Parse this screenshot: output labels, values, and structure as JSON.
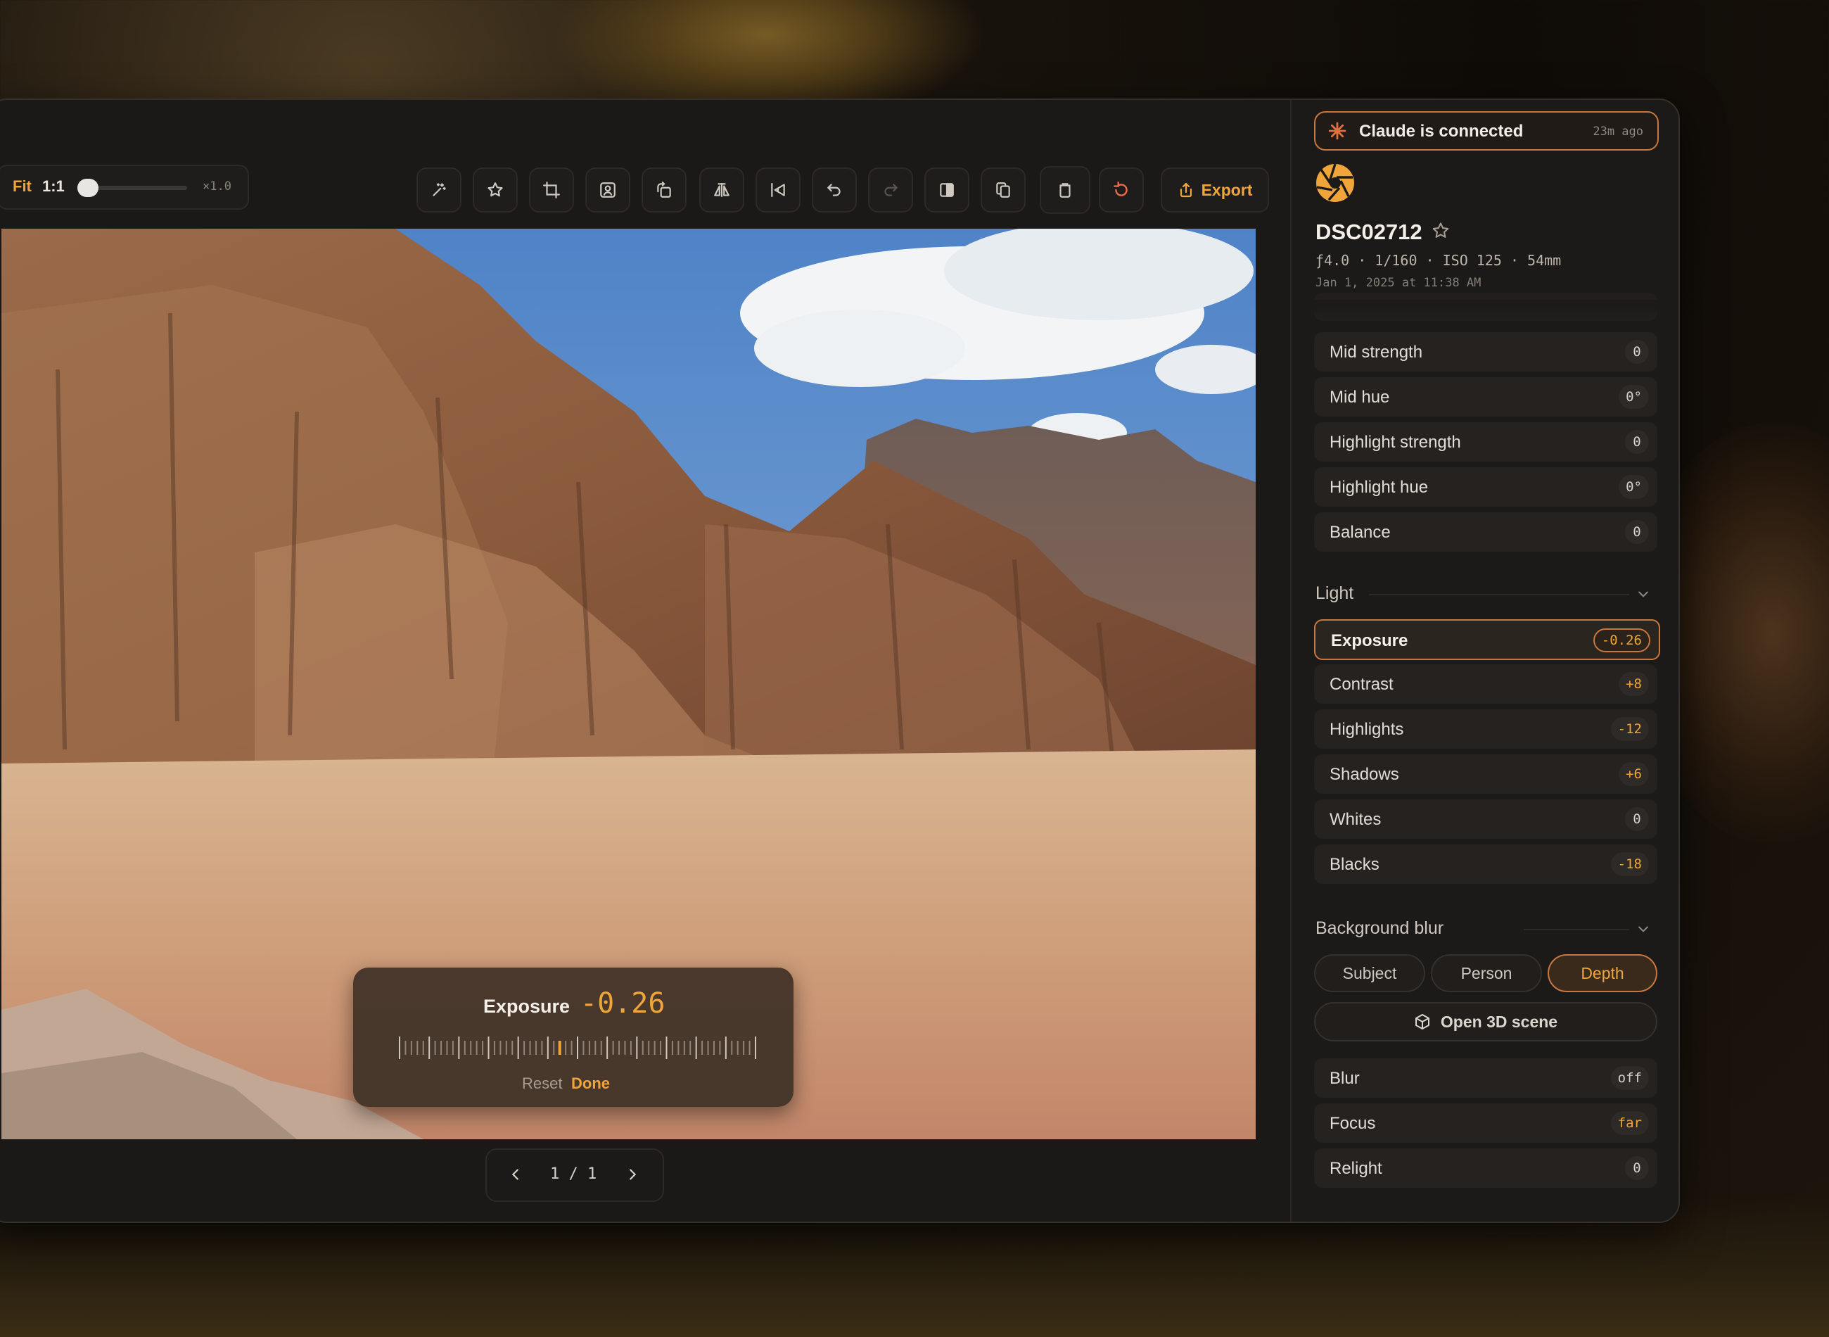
{
  "toolbar": {
    "fit_label": "Fit",
    "one_to_one_label": "1:1",
    "zoom_value": "×1.0",
    "zoom_level": 0.0,
    "export_label": "Export",
    "icons": [
      "magic-wand-icon",
      "star-icon",
      "crop-icon",
      "portrait-icon",
      "rotate-icon",
      "flip-horizontal-icon",
      "flip-vertical-icon",
      "undo-icon",
      "redo-icon",
      "compare-icon",
      "copy-icon",
      "delete-icon",
      "reset-icon",
      "export-icon"
    ]
  },
  "exposure_popup": {
    "label": "Exposure",
    "value": "-0.26",
    "reset_label": "Reset",
    "done_label": "Done"
  },
  "pager": {
    "page_text": "1 / 1"
  },
  "panel": {
    "claude": {
      "text": "Claude is connected",
      "time": "23m ago"
    },
    "file": {
      "name": "DSC02712",
      "exif": "ƒ4.0 · 1/160 · ISO 125 · 54mm",
      "date": "Jan 1, 2025 at 11:38 AM"
    },
    "color_grading": [
      {
        "label": "Mid strength",
        "value": "0"
      },
      {
        "label": "Mid hue",
        "value": "0°"
      },
      {
        "label": "Highlight strength",
        "value": "0"
      },
      {
        "label": "Highlight hue",
        "value": "0°"
      },
      {
        "label": "Balance",
        "value": "0"
      }
    ],
    "light": {
      "title": "Light",
      "rows": [
        {
          "label": "Exposure",
          "value": "-0.26"
        },
        {
          "label": "Contrast",
          "value": "+8"
        },
        {
          "label": "Highlights",
          "value": "-12"
        },
        {
          "label": "Shadows",
          "value": "+6"
        },
        {
          "label": "Whites",
          "value": "0"
        },
        {
          "label": "Blacks",
          "value": "-18"
        }
      ]
    },
    "blur": {
      "title": "Background blur",
      "modes": [
        "Subject",
        "Person",
        "Depth"
      ],
      "selected_mode": "Depth",
      "open_3d_label": "Open 3D scene",
      "rows": [
        {
          "label": "Blur",
          "value": "off"
        },
        {
          "label": "Focus",
          "value": "far"
        },
        {
          "label": "Relight",
          "value": "0"
        }
      ]
    }
  },
  "colors": {
    "accent": "#f0a53a",
    "accent_border": "#c9773f",
    "panel_bg": "#1c1a18",
    "danger": "#ef6a4a"
  }
}
